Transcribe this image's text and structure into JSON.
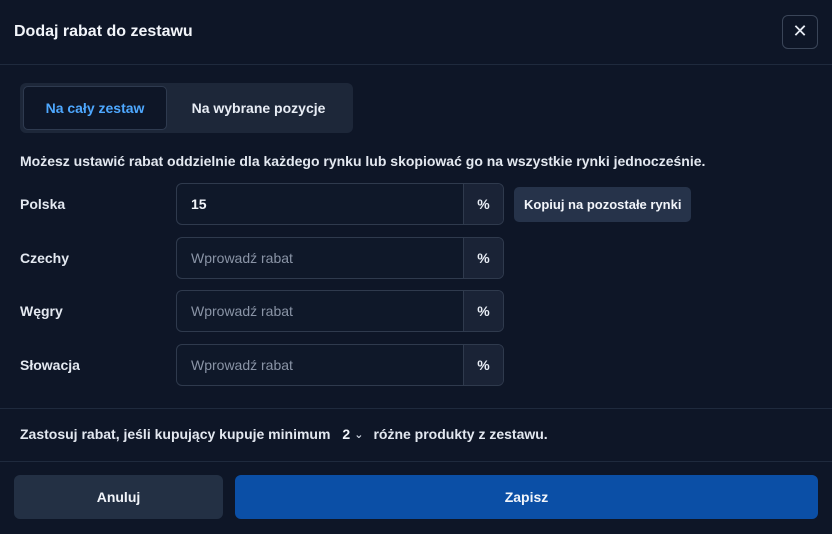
{
  "dialog": {
    "title": "Dodaj rabat do zestawu",
    "close_icon": "close-icon"
  },
  "tabs": [
    {
      "label": "Na cały zestaw",
      "active": true
    },
    {
      "label": "Na wybrane pozycje",
      "active": false
    }
  ],
  "description": "Możesz ustawić rabat oddzielnie dla każdego rynku lub skopiować go na wszystkie rynki jednocześnie.",
  "markets": [
    {
      "label": "Polska",
      "value": "15",
      "placeholder": "Wprowadź rabat",
      "suffix": "%"
    },
    {
      "label": "Czechy",
      "value": "",
      "placeholder": "Wprowadź rabat",
      "suffix": "%"
    },
    {
      "label": "Węgry",
      "value": "",
      "placeholder": "Wprowadź rabat",
      "suffix": "%"
    },
    {
      "label": "Słowacja",
      "value": "",
      "placeholder": "Wprowadź rabat",
      "suffix": "%"
    }
  ],
  "copy_button": "Kopiuj na pozostałe rynki",
  "condition": {
    "prefix": "Zastosuj rabat, jeśli kupujący kupuje minimum",
    "minimum": "2",
    "suffix": "różne produkty z zestawu."
  },
  "footer": {
    "cancel": "Anuluj",
    "save": "Zapisz"
  },
  "colors": {
    "background": "#0e1627",
    "accent": "#4ea8ff",
    "primary_button": "#0b4fa6"
  }
}
